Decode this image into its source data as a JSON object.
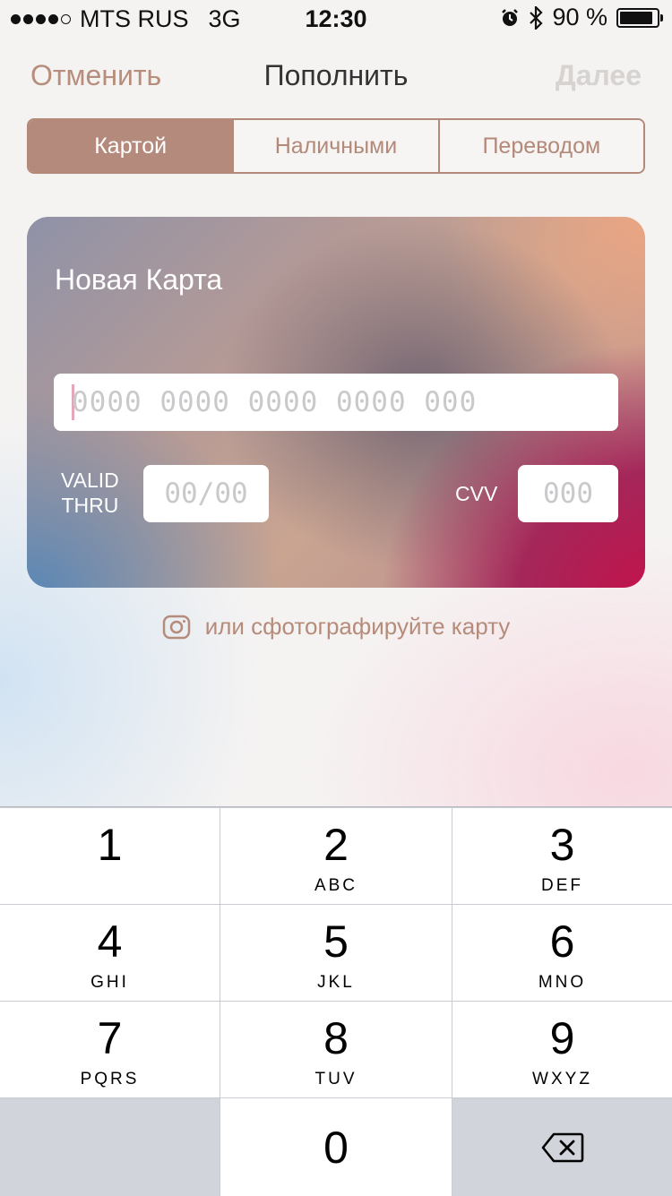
{
  "status_bar": {
    "carrier": "MTS RUS",
    "network": "3G",
    "time": "12:30",
    "battery": "90 %",
    "battery_level": 0.9,
    "icons": [
      "signal-icon",
      "alarm-icon",
      "bluetooth-icon",
      "battery-icon"
    ]
  },
  "nav": {
    "cancel": "Отменить",
    "title": "Пополнить",
    "next": "Далее"
  },
  "tabs": [
    {
      "label": "Картой",
      "active": true
    },
    {
      "label": "Наличными",
      "active": false
    },
    {
      "label": "Переводом",
      "active": false
    }
  ],
  "card": {
    "title": "Новая Карта",
    "number_placeholder": "0000 0000 0000 0000 000",
    "valid_label_line1": "VALID",
    "valid_label_line2": "THRU",
    "expiry_placeholder": "00/00",
    "cvv_label": "CVV",
    "cvv_placeholder": "000"
  },
  "photo": {
    "label": "или сфотографируйте карту",
    "icon": "camera-icon"
  },
  "keyboard": {
    "keys": [
      {
        "num": "1",
        "letters": ""
      },
      {
        "num": "2",
        "letters": "ABC"
      },
      {
        "num": "3",
        "letters": "DEF"
      },
      {
        "num": "4",
        "letters": "GHI"
      },
      {
        "num": "5",
        "letters": "JKL"
      },
      {
        "num": "6",
        "letters": "MNO"
      },
      {
        "num": "7",
        "letters": "PQRS"
      },
      {
        "num": "8",
        "letters": "TUV"
      },
      {
        "num": "9",
        "letters": "WXYZ"
      },
      {
        "num": "0",
        "letters": ""
      }
    ],
    "delete_icon": "backspace-icon"
  },
  "colors": {
    "accent": "#b38a7b",
    "disabled": "#d6d3d1",
    "card_red": "#c4124a",
    "card_blue": "#5486b8"
  }
}
